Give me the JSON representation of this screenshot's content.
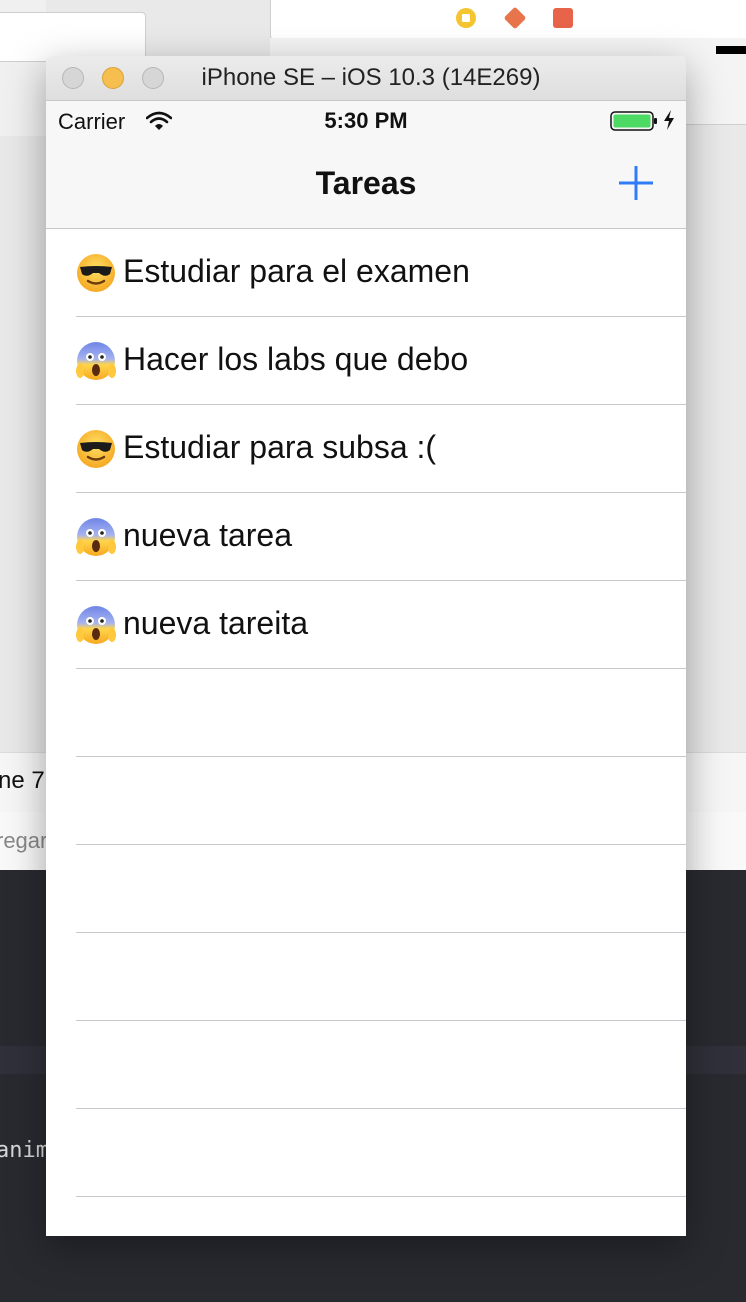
{
  "background": {
    "left_tab_text": "ne 7",
    "left_tab2_text": "regar",
    "code_fragment": "anim"
  },
  "window": {
    "title": "iPhone SE – iOS 10.3 (14E269)"
  },
  "status_bar": {
    "carrier": "Carrier",
    "time": "5:30 PM"
  },
  "nav": {
    "title": "Tareas",
    "add_icon": "plus-icon"
  },
  "tasks": [
    {
      "emoji": "sunglasses-face-icon",
      "text": "Estudiar para el examen"
    },
    {
      "emoji": "screaming-face-icon",
      "text": "Hacer los labs que debo"
    },
    {
      "emoji": "sunglasses-face-icon",
      "text": "Estudiar para subsa :("
    },
    {
      "emoji": "screaming-face-icon",
      "text": "nueva tarea"
    },
    {
      "emoji": "screaming-face-icon",
      "text": "nueva tareita"
    }
  ],
  "colors": {
    "accent": "#2f7cf6",
    "battery": "#4cd964"
  }
}
